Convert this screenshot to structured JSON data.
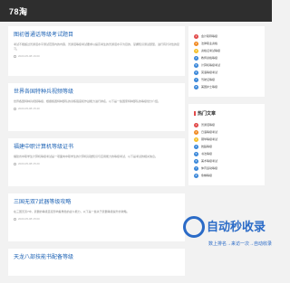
{
  "header": {
    "logo": "78淘"
  },
  "articles": [
    {
      "title": "图初普通话等级考试题目",
      "excerpt": "考试不能超过普通话水平测试范围内的内容，普通话等级考试要求以提高考生的普通话水平为目的，掌握知识测试题型，进行有针对性的复习。",
      "date": "2023-05-08 16:00"
    },
    {
      "title": "世界各国特种兵视频等级",
      "excerpt": "世界各国特种兵视频等级，根据各国特种部队的训练强度和作战能力进行排名，以下是一些国家特种部队的等级划分介绍。",
      "date": "2023-05-08 15:40"
    },
    {
      "title": "福建中职计算机等级证书",
      "excerpt": "福建省中职学生计算机等级考试是一项面向中职学生的计算机基础知识与应用能力的等级考试，以下是考试的相关信息。",
      "date": "2023-05-08 15:20"
    },
    {
      "title": "三国无双7武器等级攻略",
      "excerpt": "在三国无双7中，武器的等级直接影响着角色的战斗能力，以下是一些关于武器等级提升的攻略。",
      "date": "2023-05-08 15:00"
    },
    {
      "title": "天龙八部技能书配备等级",
      "excerpt": "",
      "date": ""
    }
  ],
  "sidebar": {
    "section1": [
      "会计职称等级",
      "法律职业资格",
      "资格证考试等级",
      "教师资格等级",
      "计算机等级考试",
      "英语等级考试",
      "驾驶证等级",
      "美国护士等级"
    ],
    "section2_title": "热门文章",
    "section2": [
      "普通话等级",
      "日语等级考试",
      "钢琴等级考试",
      "舞蹈等级",
      "书法等级",
      "美术等级考试",
      "体育运动等级",
      "象棋等级"
    ]
  },
  "colors": {
    "rank": [
      "#e24b4b",
      "#f08a24",
      "#f5c12c",
      "#3a87d9",
      "#3a87d9",
      "#3a87d9",
      "#3a87d9",
      "#3a87d9"
    ]
  },
  "watermark": {
    "main": "自动秒收录",
    "sub": "数上排名→来访一次→自动收录"
  }
}
